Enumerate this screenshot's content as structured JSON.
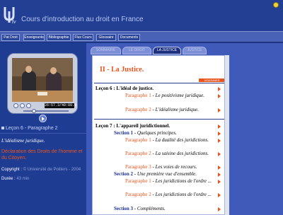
{
  "header": {
    "site_title": "Cours d'introduction au droit en France",
    "logo_text": "tv"
  },
  "nav": {
    "items": [
      "Pat Droit",
      "Enseignants",
      "Bibliographie",
      "Flux Cours",
      "Glossaire",
      "Documents"
    ]
  },
  "player": {
    "timecode": "26:57.3/40:09.0"
  },
  "left": {
    "lesson_label": "Leçon 6 - Paragraphe 2",
    "paragraph_title": "L'idéalisme juridique.",
    "declaration": "Déclaration des Droits de l'homme et du Citoyen.",
    "copyright_label": "Copyright :",
    "copyright_value": "© Université de Poitiers - 2004",
    "duree_label": "Durée :",
    "duree_value": "43 min"
  },
  "tabs": [
    {
      "label": "SOMMAIRE"
    },
    {
      "label": "LE DROIT"
    },
    {
      "label": "LA JUSTICE",
      "active": true
    },
    {
      "label": "JUSTICE"
    }
  ],
  "content": {
    "title": "II - La Justice.",
    "visionner": "VISIONNER",
    "lecon6": {
      "heading": "Leçon 6 : L'idéal de justice.",
      "paragraphs": [
        {
          "key": "Paragraphe 1",
          "text": "Le positivisme juridique."
        },
        {
          "key": "Paragraphe 2",
          "text": "L'idéalisme juridique."
        }
      ]
    },
    "lecon7": {
      "heading": "Leçon 7 : L'appareil juridictionnel.",
      "section1": {
        "key": "Section 1",
        "text": "Quelques principes."
      },
      "s1_paragraphs": [
        {
          "key": "Paragraphe 1",
          "text": "La dualité des juridictions."
        },
        {
          "key": "Paragraphe 2",
          "text": "La saisine des juridictions."
        },
        {
          "key": "Paragraphe 3",
          "text": "Les voies de recours."
        }
      ],
      "section2": {
        "key": "Section 2",
        "text": "Une première vue d'ensemble."
      },
      "s2_paragraphs": [
        {
          "key": "Paragraphe 1",
          "text": "Les juridictions de l'ordre ..."
        },
        {
          "key": "Paragraphe 2",
          "text": "Les juridictions de l'ordre ..."
        }
      ],
      "section3": {
        "key": "Section 3",
        "text": "Compléments."
      }
    }
  }
}
